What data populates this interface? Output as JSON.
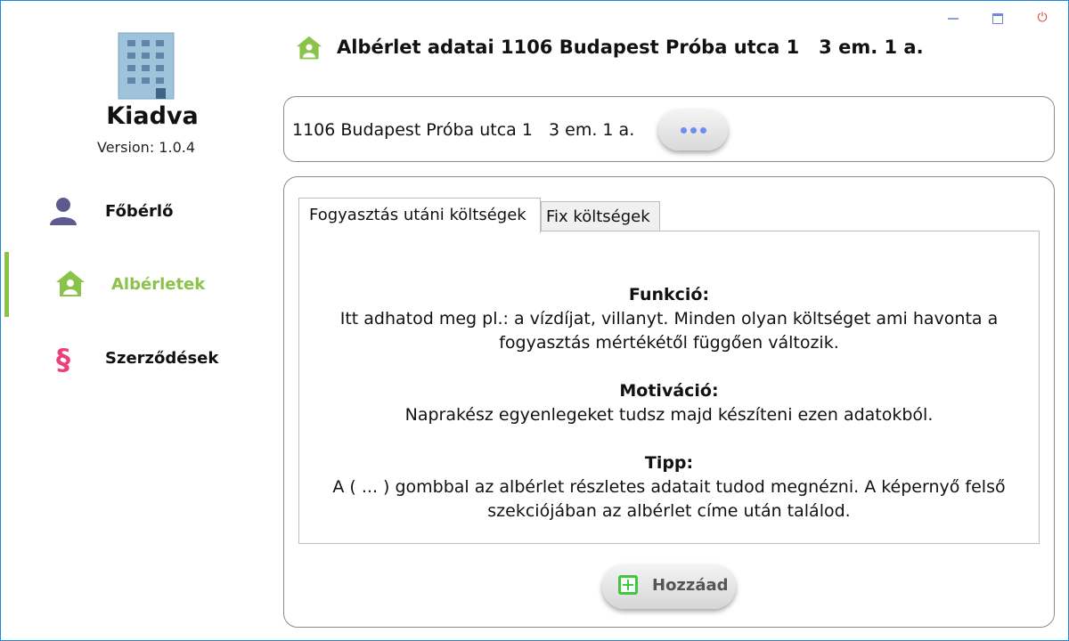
{
  "app": {
    "name": "Kiadva",
    "version": "Version: 1.0.4"
  },
  "window_controls": [
    "minimize-icon",
    "maximize-icon",
    "power-icon"
  ],
  "sidebar": {
    "items": [
      {
        "label": "Főbérlő",
        "icon": "person-icon",
        "active": false
      },
      {
        "label": "Albérletek",
        "icon": "house-person-icon",
        "active": true
      },
      {
        "label": "Szerződések",
        "icon": "section-sign-icon",
        "active": false
      }
    ]
  },
  "header": {
    "title": "Albérlet adatai 1106 Budapest Próba utca 1   3 em. 1 a.",
    "icon": "house-person-icon"
  },
  "address": {
    "text": "1106 Budapest Próba utca 1   3 em. 1 a.",
    "details_button_icon": "more-dots-icon"
  },
  "tabs": [
    {
      "label": "Fogyasztás utáni költségek",
      "active": true
    },
    {
      "label": "Fix költségek",
      "active": false
    }
  ],
  "info": {
    "function_title": "Funkció:",
    "function_text": "Itt adhatod meg pl.: a vízdíjat, villanyt. Minden olyan költséget ami havonta a fogyasztás mértékétől függően változik.",
    "motivation_title": "Motiváció:",
    "motivation_text": "Naprakész egyenlegeket tudsz majd készíteni ezen adatokból.",
    "tip_title": "Tipp:",
    "tip_text": "A ( ... ) gombbal az albérlet részletes adatait tudod megnézni. A képernyő felső szekciójában az albérlet címe után találod."
  },
  "add_button": {
    "label": "Hozzáad",
    "icon": "plus-square-icon"
  },
  "colors": {
    "accent_green": "#8bc34a",
    "person_icon": "#5e5a8f",
    "section_icon": "#ec407a",
    "close_red": "#e53935",
    "window_border": "#1e88e5",
    "dots_blue": "#6f8df0",
    "plus_green": "#3ec83e"
  }
}
